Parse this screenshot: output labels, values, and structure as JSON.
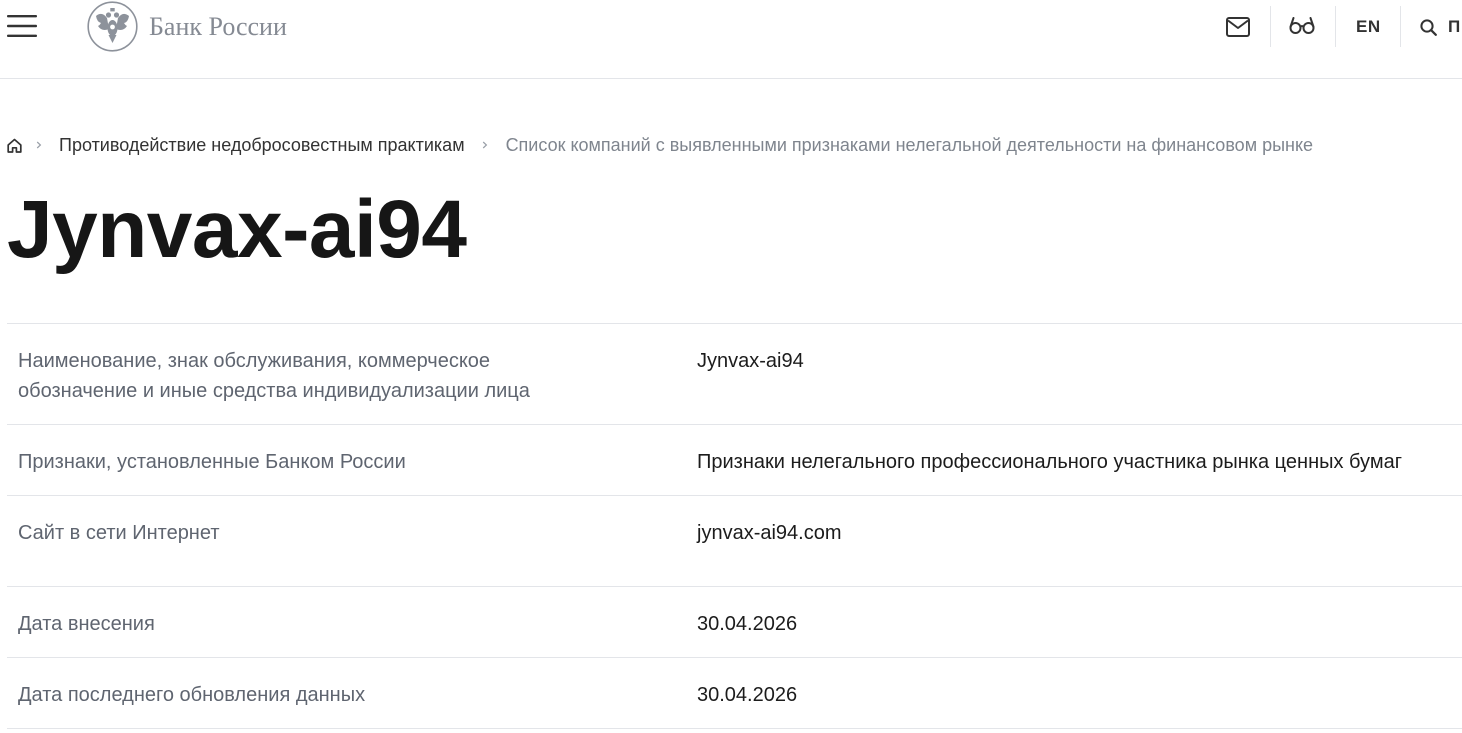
{
  "header": {
    "logo_text": "Банк России",
    "lang_label": "EN",
    "search_label": "П"
  },
  "icons": {
    "menu": "hamburger-menu-icon",
    "logo": "bank-of-russia-emblem-icon",
    "mail": "mail-icon",
    "accessibility": "glasses-icon",
    "search": "search-icon",
    "home": "home-icon",
    "separator": "chevron-right-icon"
  },
  "breadcrumb": {
    "items": [
      {
        "label": "Противодействие недобросовестным практикам"
      },
      {
        "label": "Список компаний с выявленными признаками нелегальной деятельности на финансовом рынке"
      }
    ]
  },
  "page_title": "Jynvax-ai94",
  "details": {
    "rows": [
      {
        "label": "Наименование, знак обслуживания, коммерческое обозначение и иные средства индивидуализации лица",
        "value": "Jynvax-ai94"
      },
      {
        "label": "Признаки, установленные Банком России",
        "value": "Признаки нелегального профессионального участника рынка ценных бумаг"
      },
      {
        "label": "Сайт в сети Интернет",
        "value": "jynvax-ai94.com"
      },
      {
        "label": "Дата внесения",
        "value": "30.04.2026"
      },
      {
        "label": "Дата последнего обновления данных",
        "value": "30.04.2026"
      }
    ]
  },
  "colors": {
    "text_primary": "#1c1c1c",
    "text_secondary": "#5f6570",
    "border": "#e3e5e9",
    "logo_gray": "#858a93",
    "breadcrumb_muted": "#7f858e",
    "icon": "#333333"
  }
}
